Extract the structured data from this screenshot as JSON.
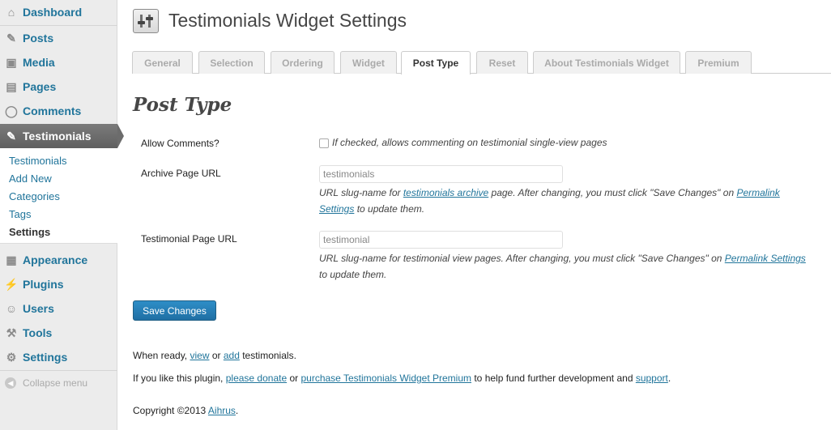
{
  "sidebar": {
    "items": [
      {
        "label": "Dashboard",
        "icon": "dashboard-icon"
      },
      {
        "label": "Posts",
        "icon": "pin-icon"
      },
      {
        "label": "Media",
        "icon": "media-icon"
      },
      {
        "label": "Pages",
        "icon": "pages-icon"
      },
      {
        "label": "Comments",
        "icon": "comment-icon"
      },
      {
        "label": "Testimonials",
        "icon": "pin-icon"
      },
      {
        "label": "Appearance",
        "icon": "appearance-icon"
      },
      {
        "label": "Plugins",
        "icon": "plug-icon"
      },
      {
        "label": "Users",
        "icon": "users-icon"
      },
      {
        "label": "Tools",
        "icon": "tools-icon"
      },
      {
        "label": "Settings",
        "icon": "settings-icon"
      }
    ],
    "submenu": [
      "Testimonials",
      "Add New",
      "Categories",
      "Tags",
      "Settings"
    ],
    "collapse_label": "Collapse menu"
  },
  "header": {
    "title": "Testimonials Widget Settings"
  },
  "tabs": [
    "General",
    "Selection",
    "Ordering",
    "Widget",
    "Post Type",
    "Reset",
    "About Testimonials Widget",
    "Premium"
  ],
  "active_tab": "Post Type",
  "section": {
    "title": "Post Type"
  },
  "fields": {
    "allow_comments": {
      "label": "Allow Comments?",
      "description": "If checked, allows commenting on testimonial single-view pages"
    },
    "archive_url": {
      "label": "Archive Page URL",
      "value": "testimonials",
      "desc_prefix": "URL slug-name for ",
      "desc_link1": "testimonials archive",
      "desc_middle": " page. After changing, you must click \"Save Changes\" on ",
      "desc_link2": "Permalink",
      "desc_link3": "Settings",
      "desc_suffix": " to update them."
    },
    "testimonial_url": {
      "label": "Testimonial Page URL",
      "value": "testimonial",
      "desc_prefix": "URL slug-name for testimonial view pages. After changing, you must click \"Save Changes\" on ",
      "desc_link": "Permalink Settings",
      "desc_suffix": "to update them."
    }
  },
  "save_button": "Save Changes",
  "footer": {
    "line1_prefix": "When ready, ",
    "line1_link1": "view",
    "line1_middle": " or ",
    "line1_link2": "add",
    "line1_suffix": " testimonials.",
    "line2_prefix": "If you like this plugin, ",
    "line2_link1": "please donate",
    "line2_middle1": " or ",
    "line2_link2": "purchase Testimonials Widget Premium",
    "line2_middle2": " to help fund further development and ",
    "line2_link3": "support",
    "line2_suffix": ".",
    "line3_prefix": "Copyright ©2013 ",
    "line3_link": "Aihrus",
    "line3_suffix": "."
  },
  "colors": {
    "link": "#21759b",
    "active_menu": "#6c6c6c",
    "button": "#2586bd"
  }
}
